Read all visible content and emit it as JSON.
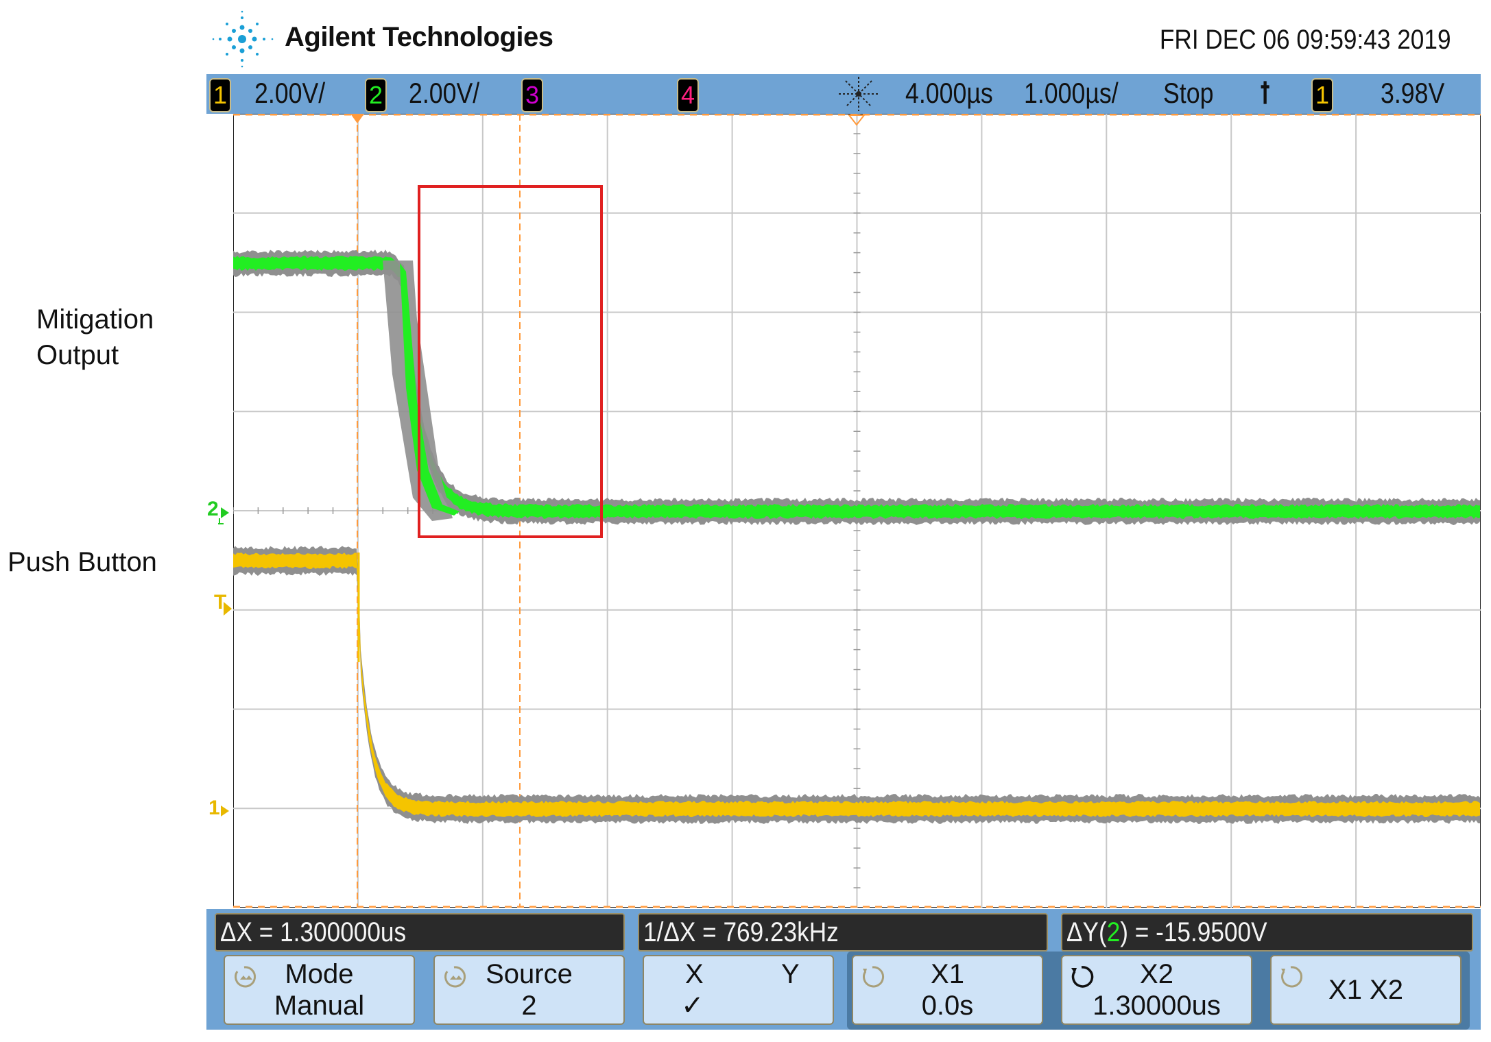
{
  "header": {
    "brand": "Agilent Technologies",
    "datetime": "FRI DEC 06 09:59:43 2019"
  },
  "labels": {
    "mitigation_line1": "Mitigation",
    "mitigation_line2": "Output",
    "push_button": "Push Button"
  },
  "topbar": {
    "ch1_badge": "1",
    "ch1_scale": "2.00V/",
    "ch2_badge": "2",
    "ch2_scale": "2.00V/",
    "ch3_badge": "3",
    "ch4_badge": "4",
    "time_delay": "4.000µs",
    "time_scale": "1.000µs/",
    "run_state": "Stop",
    "trigger_source_badge": "1",
    "trigger_level": "3.98V"
  },
  "markers": {
    "ch2": "2",
    "trigger": "T",
    "ch1": "1"
  },
  "measurements": {
    "delta_x": "ΔX = 1.300000us",
    "inv_delta_x": "1/ΔX = 769.23kHz",
    "delta_y_prefix": "ΔY(",
    "delta_y_channel": "2",
    "delta_y_suffix": ") = -15.9500V"
  },
  "softkeys": [
    {
      "line1": "Mode",
      "line2": "Manual"
    },
    {
      "line1": "Source",
      "line2": "2"
    },
    {
      "line1": "X",
      "line1b": "Y",
      "line2": "✓"
    },
    {
      "line1": "X1",
      "line2": "0.0s"
    },
    {
      "line1": "X2",
      "line2": "1.30000us"
    },
    {
      "line1": "X1 X2",
      "line2": ""
    }
  ],
  "colors": {
    "ch1": "#f5c400",
    "ch2": "#22ee22",
    "ch3": "#d000d0",
    "ch4": "#ff2080",
    "cursor": "#ff9a3c",
    "highlight_box": "#e02020",
    "bar": "#6fa3d4"
  }
}
